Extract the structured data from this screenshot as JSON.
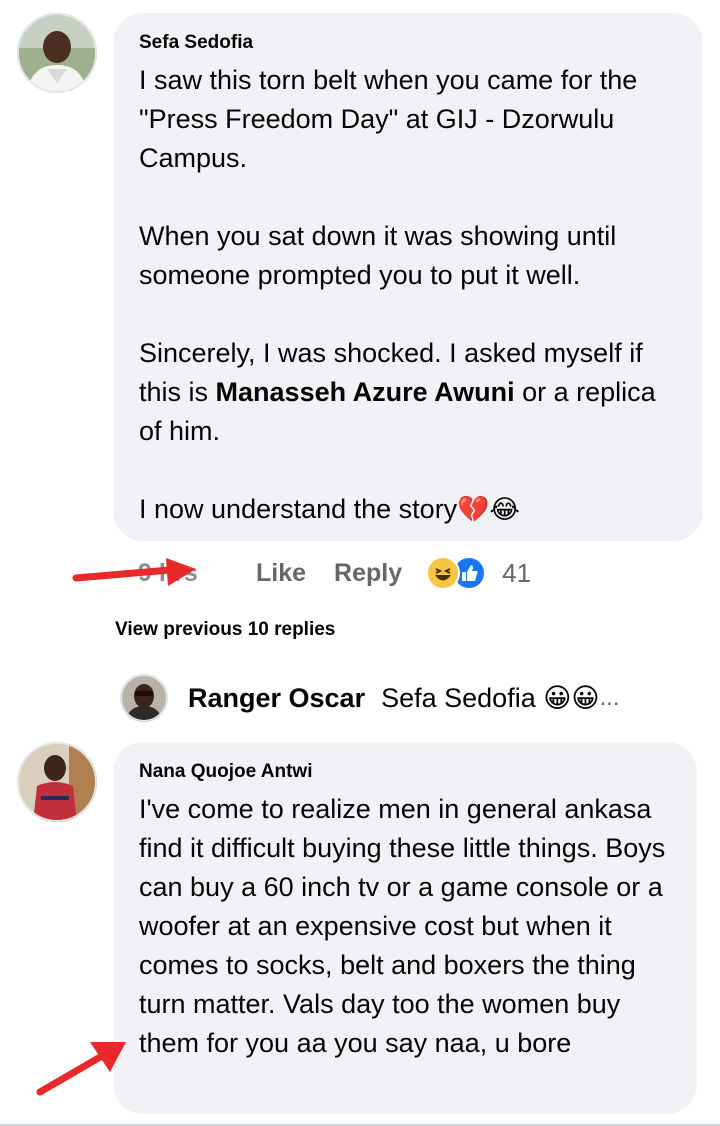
{
  "comment1": {
    "author": "Sefa Sedofia",
    "paragraphs": [
      "I saw this torn belt when you came for the \"Press Freedom Day\" at GIJ - Dzorwulu Campus.",
      "When you sat down it was showing until someone prompted you to put it well."
    ],
    "para3_before": "Sincerely, I was shocked. I asked myself if this is ",
    "para3_bold": "Manasseh Azure Awuni",
    "para3_after": " or a replica of him.",
    "para4_text": "I now understand the story",
    "para4_emoji": "💔😂",
    "time": "9 hrs",
    "like_label": "Like",
    "reply_label": "Reply",
    "reaction_count": "41"
  },
  "view_previous_label": "View previous 10 replies",
  "reply_preview": {
    "author": "Ranger Oscar",
    "snippet": "Sefa Sedofia 😀😀",
    "ellipsis": "..."
  },
  "comment2": {
    "author": "Nana Quojoe Antwi",
    "text": "I've come to realize men in general ankasa find it difficult buying these little things. Boys can buy a 60 inch tv or a game console or a woofer at an expensive cost but when it comes to socks, belt and boxers the thing turn matter. Vals day too the women buy them for you aa you say naa, u bore"
  },
  "colors": {
    "bubble": "#f0f2f5",
    "action_text": "#65676b",
    "annotation_arrow": "#e8282b",
    "like_blue": "#1877f2",
    "haha_yellow": "#f7c544"
  },
  "icons": {
    "haha_reaction": "haha-reaction-icon",
    "like_reaction": "like-reaction-icon"
  }
}
